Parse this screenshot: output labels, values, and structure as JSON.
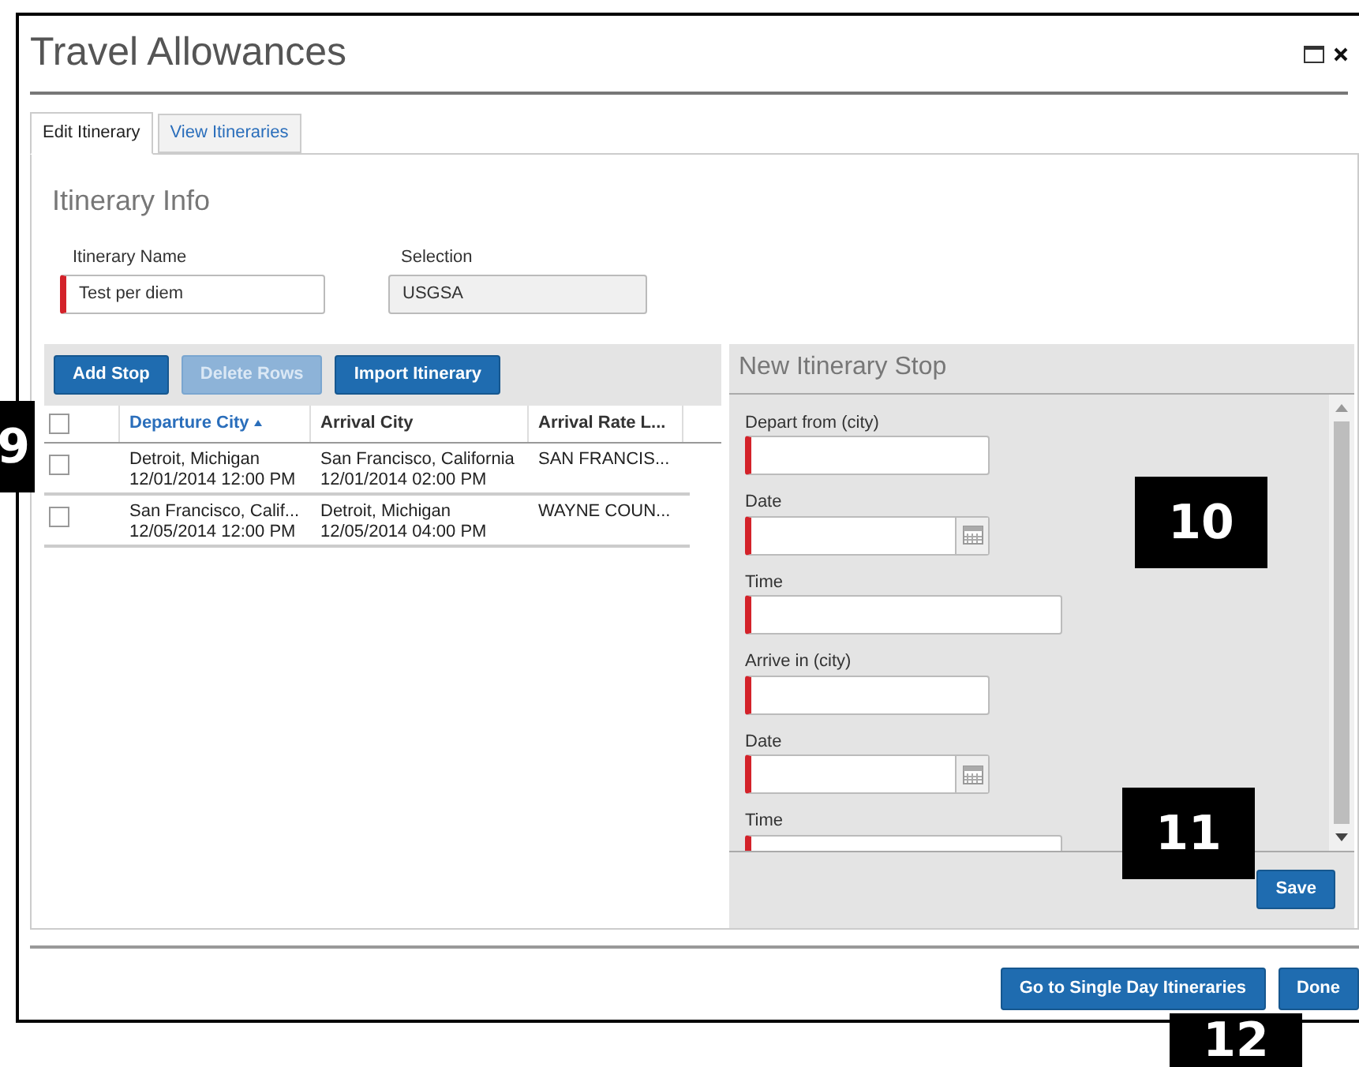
{
  "window": {
    "title": "Travel Allowances"
  },
  "tabs": [
    {
      "label": "Edit Itinerary",
      "selected": true
    },
    {
      "label": "View Itineraries",
      "selected": false
    }
  ],
  "itinerary_info": {
    "heading": "Itinerary Info",
    "fields": [
      {
        "label": "Itinerary Name",
        "value": "Test per diem",
        "required": true,
        "disabled": false
      },
      {
        "label": "Selection",
        "value": "USGSA",
        "required": false,
        "disabled": true
      }
    ]
  },
  "toolbar": [
    {
      "label": "Add Stop",
      "disabled": false
    },
    {
      "label": "Delete Rows",
      "disabled": true
    },
    {
      "label": "Import Itinerary",
      "disabled": false
    }
  ],
  "table": {
    "header_checked": false,
    "columns": [
      {
        "label": "Departure City",
        "sorted": true
      },
      {
        "label": "Arrival City",
        "sorted": false
      },
      {
        "label": "Arrival Rate L...",
        "sorted": false
      }
    ],
    "rows": [
      {
        "checked": false,
        "cells": [
          [
            "Detroit, Michigan",
            "12/01/2014 12:00 PM"
          ],
          [
            "San Francisco, California",
            "12/01/2014 02:00 PM"
          ],
          [
            "SAN FRANCIS..."
          ]
        ]
      },
      {
        "checked": false,
        "cells": [
          [
            "San Francisco, Calif...",
            "12/05/2014 12:00 PM"
          ],
          [
            "Detroit, Michigan",
            "12/05/2014 04:00 PM"
          ],
          [
            "WAYNE COUN..."
          ]
        ]
      }
    ]
  },
  "new_stop": {
    "heading": "New Itinerary Stop",
    "fields": [
      {
        "kind": "city",
        "label": "Depart from (city)"
      },
      {
        "kind": "date",
        "label": "Date"
      },
      {
        "kind": "time",
        "label": "Time"
      },
      {
        "kind": "city",
        "label": "Arrive in (city)"
      },
      {
        "kind": "date",
        "label": "Date"
      },
      {
        "kind": "time",
        "label": "Time"
      }
    ],
    "save": "Save"
  },
  "footer_buttons": [
    "Go to Single Day Itineraries",
    "Done"
  ],
  "callouts": [
    "9",
    "10",
    "11",
    "12"
  ]
}
